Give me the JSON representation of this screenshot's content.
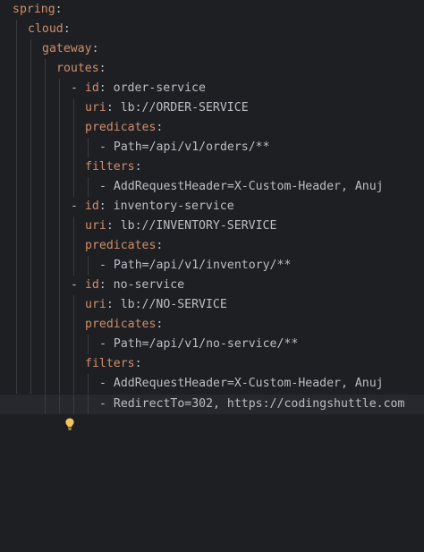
{
  "lines": [
    {
      "key": "spring",
      "colon": ":"
    },
    {
      "key": "cloud",
      "colon": ":"
    },
    {
      "key": "gateway",
      "colon": ":"
    },
    {
      "key": "routes",
      "colon": ":"
    },
    {
      "dash": "- ",
      "key": "id",
      "colon": ": ",
      "value": "order-service"
    },
    {
      "key": "uri",
      "colon": ": ",
      "value": "lb://ORDER-SERVICE"
    },
    {
      "key": "predicates",
      "colon": ":"
    },
    {
      "dash": "- ",
      "value": "Path=/api/v1/orders/**"
    },
    {
      "key": "filters",
      "colon": ":"
    },
    {
      "dash": "- ",
      "value": "AddRequestHeader=X-Custom-Header, Anuj"
    },
    {
      "dash": "- ",
      "key": "id",
      "colon": ": ",
      "value": "inventory-service"
    },
    {
      "key": "uri",
      "colon": ": ",
      "value": "lb://INVENTORY-SERVICE"
    },
    {
      "key": "predicates",
      "colon": ":"
    },
    {
      "dash": "- ",
      "value": "Path=/api/v1/inventory/**"
    },
    {
      "dash": "- ",
      "key": "id",
      "colon": ": ",
      "value": "no-service"
    },
    {
      "key": "uri",
      "colon": ": ",
      "value": "lb://NO-SERVICE"
    },
    {
      "key": "predicates",
      "colon": ":"
    },
    {
      "dash": "- ",
      "value": "Path=/api/v1/no-service/**"
    },
    {
      "key": "filters",
      "colon": ":"
    },
    {
      "dash": "- ",
      "value": "AddRequestHeader=X-Custom-Header, Anuj"
    },
    {
      "dash": "- ",
      "value": "RedirectTo=302, https://codingshuttle.com"
    }
  ],
  "gutter": {
    "icon": "lightbulb-icon"
  },
  "colors": {
    "background": "#1e1f22",
    "key": "#cf8e6d",
    "text": "#bcbec4",
    "current_line": "#26282e",
    "indent_guide": "#393b40",
    "bulb": "#f2c55c"
  }
}
